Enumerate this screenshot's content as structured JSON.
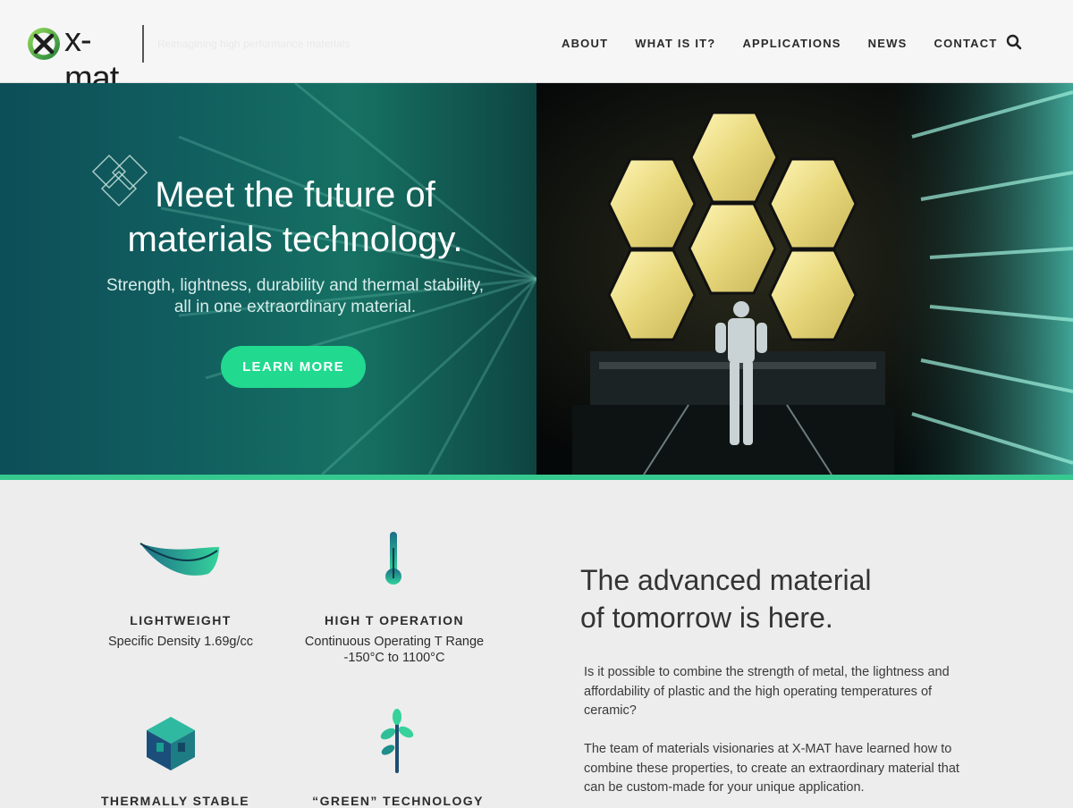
{
  "brand": {
    "logo_text": "x-mat",
    "tagline": "Reimagining high performance materials"
  },
  "nav": {
    "items": [
      "ABOUT",
      "WHAT IS IT?",
      "APPLICATIONS",
      "NEWS",
      "CONTACT"
    ]
  },
  "hero": {
    "title_line1": "Meet the future of",
    "title_line2": "materials technology.",
    "subtitle_line1": "Strength, lightness, durability and thermal stability,",
    "subtitle_line2": "all in one extraordinary material.",
    "cta_label": "LEARN MORE",
    "accent_color": "#21d98f"
  },
  "features": [
    {
      "icon": "feather-icon",
      "title": "LIGHTWEIGHT",
      "desc_line1": "Specific Density 1.69g/cc",
      "desc_line2": ""
    },
    {
      "icon": "thermometer-icon",
      "title": "HIGH T OPERATION",
      "desc_line1": "Continuous Operating T Range",
      "desc_line2": "-150°C to 1100°C"
    },
    {
      "icon": "cube-icon",
      "title": "THERMALLY STABLE",
      "desc_line1": "",
      "desc_line2": ""
    },
    {
      "icon": "sprout-icon",
      "title": "“GREEN” TECHNOLOGY",
      "desc_line1": "",
      "desc_line2": ""
    }
  ],
  "intro": {
    "heading_line1": "The advanced material",
    "heading_line2": "of tomorrow is here.",
    "para1": "Is it possible to combine the strength of metal, the lightness and affordability of plastic and the high operating temperatures of ceramic?",
    "para2": "The team of materials visionaries at X-MAT have learned how to combine these properties, to create an extraordinary material that can be custom-made for your unique application."
  }
}
